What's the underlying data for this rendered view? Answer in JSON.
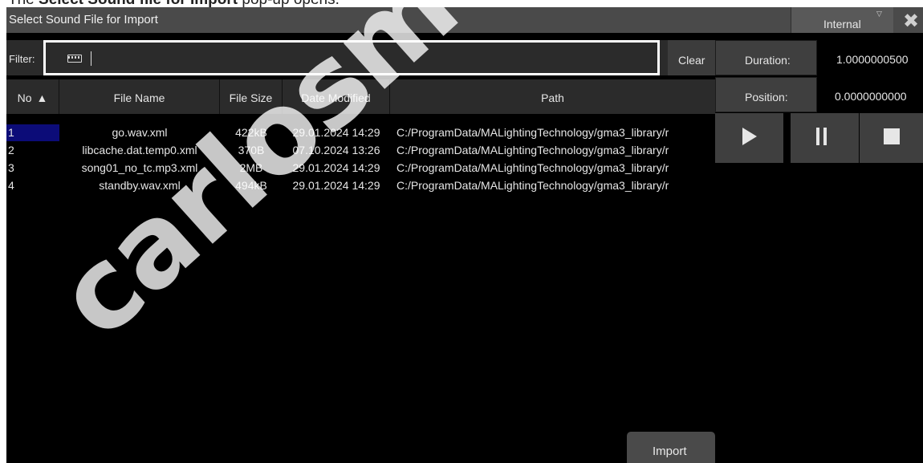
{
  "caption": {
    "prefix": "The ",
    "bold": "Select Sound file for Import",
    "suffix": " pop-up opens."
  },
  "window": {
    "title": "Select Sound File for Import",
    "source_button": "Internal",
    "close_icon": "close-icon"
  },
  "filter": {
    "label": "Filter:",
    "value": "",
    "clear_label": "Clear",
    "keyboard_icon": "keyboard-icon"
  },
  "info": {
    "duration_label": "Duration:",
    "duration_value": "1.0000000500",
    "position_label": "Position:",
    "position_value": "0.0000000000"
  },
  "transport": {
    "play_icon": "play-icon",
    "pause_icon": "pause-icon",
    "stop_icon": "stop-icon"
  },
  "table": {
    "columns": [
      "No",
      "File Name",
      "File Size",
      "Date Modified",
      "Path"
    ],
    "sort_column": "No",
    "sort_direction": "ascending",
    "rows": [
      {
        "no": "1",
        "name": "go.wav.xml",
        "size": "422kB",
        "date": "29.01.2024 14:29",
        "path": "C:/ProgramData/MALightingTechnology/gma3_library/r"
      },
      {
        "no": "2",
        "name": "libcache.dat.temp0.xml",
        "size": "370B",
        "date": "07.10.2024 13:26",
        "path": "C:/ProgramData/MALightingTechnology/gma3_library/r"
      },
      {
        "no": "3",
        "name": "song01_no_tc.mp3.xml",
        "size": "2MB",
        "date": "29.01.2024 14:29",
        "path": "C:/ProgramData/MALightingTechnology/gma3_library/r"
      },
      {
        "no": "4",
        "name": "standby.wav.xml",
        "size": "494kB",
        "date": "29.01.2024 14:29",
        "path": "C:/ProgramData/MALightingTechnology/gma3_library/r"
      }
    ],
    "selected_row": "1"
  },
  "footer": {
    "import_label": "Import"
  },
  "watermark": "carlosmeno",
  "colors": {
    "background": "#000000",
    "titlebar": "#4a4a4a",
    "selection": "#0c0c78",
    "highlight_box": "#ffffff"
  }
}
